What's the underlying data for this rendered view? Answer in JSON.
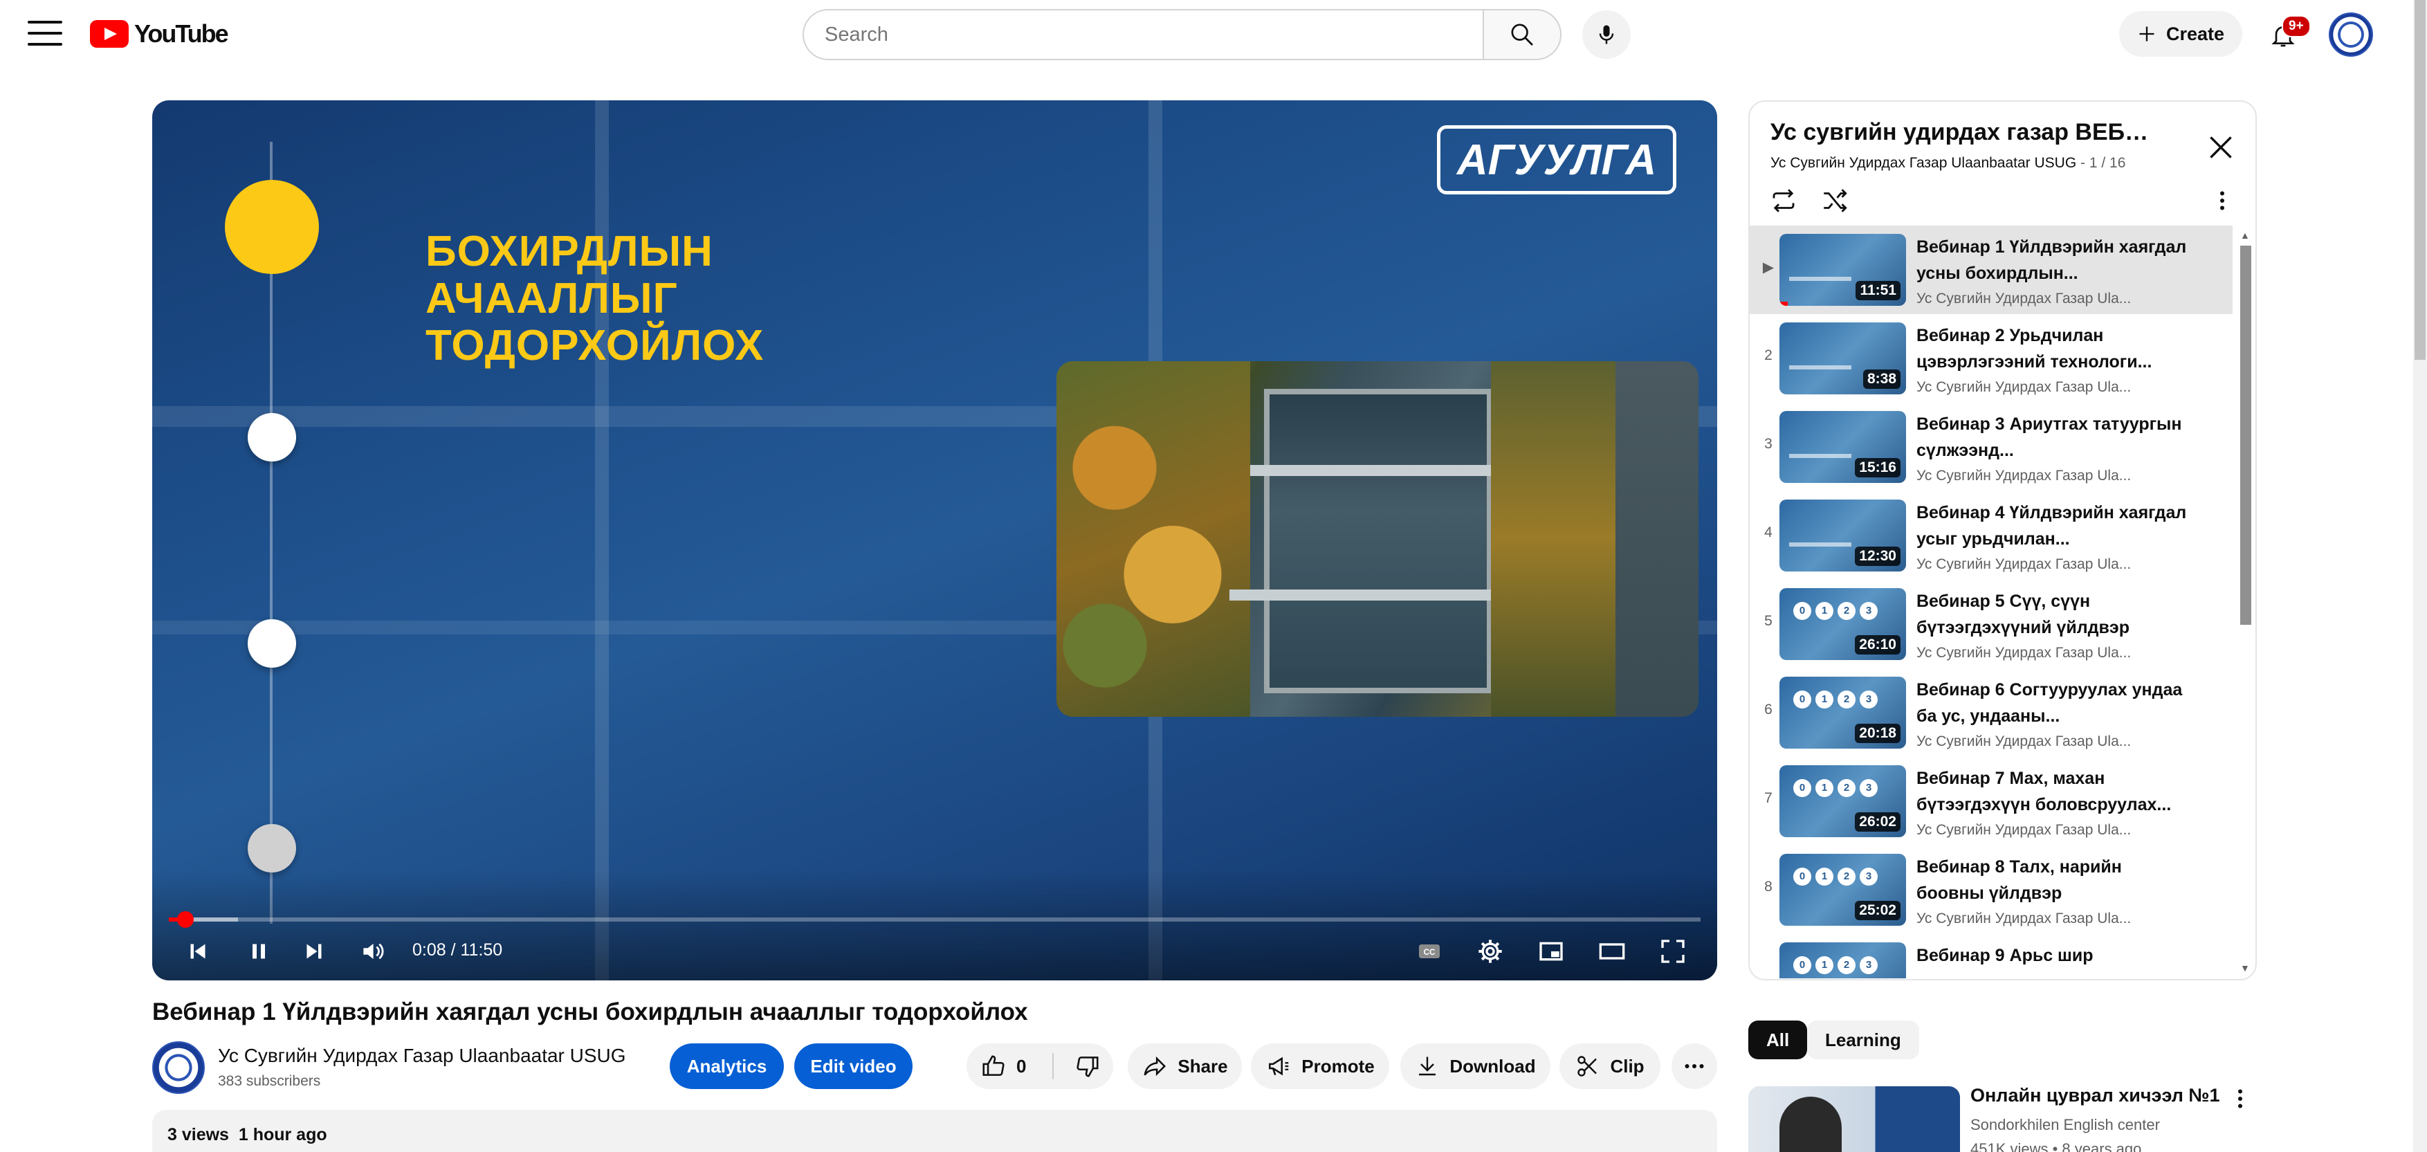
{
  "header": {
    "logo_text": "YouTube",
    "search_placeholder": "Search",
    "create_label": "Create",
    "notification_count": "9+"
  },
  "player": {
    "slide_title_lines": [
      "БОХИРДЛЫН",
      "АЧААЛЛЫГ",
      "ТОДОРХОЙЛОХ"
    ],
    "agenda_label": "АГУУЛГА",
    "time_display": "0:08 / 11:50",
    "progress_played_fraction": 0.011,
    "progress_buffered_fraction": 0.045,
    "colors": {
      "slide_accent": "#fcc916",
      "progress": "#ff0000"
    }
  },
  "video": {
    "title": "Вебинар 1 Үйлдвэрийн хаягдал усны бохирдлын ачааллыг тодорхойлох",
    "channel_name": "Ус Сувгийн Удирдах Газар Ulaanbaatar USUG",
    "subscribers": "383 subscribers",
    "analytics_label": "Analytics",
    "edit_label": "Edit video",
    "like_count": "0",
    "share_label": "Share",
    "promote_label": "Promote",
    "download_label": "Download",
    "clip_label": "Clip",
    "views_date": "3 views  1 hour ago"
  },
  "playlist": {
    "title": "Ус сувгийн удирдах газар ВЕБИНАР",
    "channel": "Ус Сувгийн Удирдах Газар Ulaanbaatar USUG",
    "position": " - 1 / 16",
    "items": [
      {
        "num": "▶",
        "title": "Вебинар 1 Үйлдвэрийн хаягдал усны бохирдлын...",
        "channel": "Ус Сувгийн Удирдах Газар Ula...",
        "duration": "11:51",
        "active": true
      },
      {
        "num": "2",
        "title": "Вебинар 2 Урьдчилан цэвэрлэгээний технологи...",
        "channel": "Ус Сувгийн Удирдах Газар Ula...",
        "duration": "8:38"
      },
      {
        "num": "3",
        "title": "Вебинар 3 Ариутгах татуургын сүлжээнд...",
        "channel": "Ус Сувгийн Удирдах Газар Ula...",
        "duration": "15:16"
      },
      {
        "num": "4",
        "title": "Вебинар 4 Үйлдвэрийн хаягдал усыг урьдчилан...",
        "channel": "Ус Сувгийн Удирдах Газар Ula...",
        "duration": "12:30"
      },
      {
        "num": "5",
        "title": "Вебинар 5 Сүү, сүүн бүтээгдэхүүний үйлдвэр",
        "channel": "Ус Сувгийн Удирдах Газар Ula...",
        "duration": "26:10"
      },
      {
        "num": "6",
        "title": "Вебинар 6 Согтууруулах ундаа ба ус, ундааны...",
        "channel": "Ус Сувгийн Удирдах Газар Ula...",
        "duration": "20:18"
      },
      {
        "num": "7",
        "title": "Вебинар 7 Мах, махан бүтээгдэхүүн боловсруулах...",
        "channel": "Ус Сувгийн Удирдах Газар Ula...",
        "duration": "26:02"
      },
      {
        "num": "8",
        "title": "Вебинар 8 Талх, нарийн боовны үйлдвэр",
        "channel": "Ус Сувгийн Удирдах Газар Ula...",
        "duration": "25:02"
      },
      {
        "num": "",
        "title": "Вебинар 9 Арьс шир",
        "channel": "",
        "duration": ""
      }
    ]
  },
  "chips": [
    "All",
    "Learning"
  ],
  "recommendation": {
    "title": "Онлайн цуврал хичээл №1",
    "channel": "Sondorkhilen English center",
    "meta": "451K views • 8 years ago"
  }
}
